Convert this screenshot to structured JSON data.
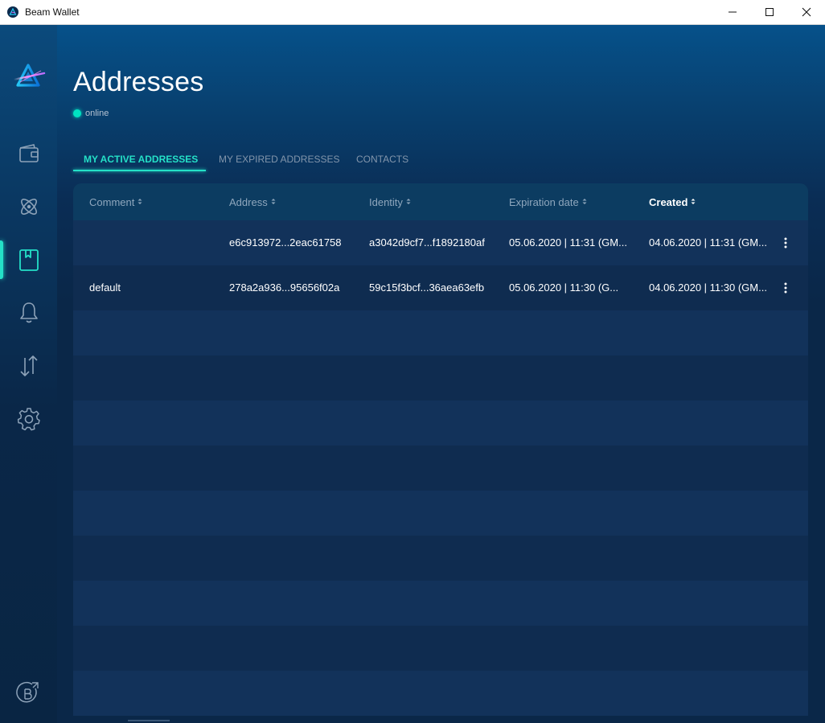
{
  "window": {
    "title": "Beam Wallet"
  },
  "page": {
    "title": "Addresses",
    "status": "online"
  },
  "sidebar": {
    "items": [
      {
        "name": "wallet",
        "icon": "wallet-icon"
      },
      {
        "name": "atomic-swap",
        "icon": "atom-icon"
      },
      {
        "name": "addresses",
        "icon": "address-book-icon",
        "active": true
      },
      {
        "name": "notifications",
        "icon": "bell-icon"
      },
      {
        "name": "utxo",
        "icon": "transfer-arrows-icon"
      },
      {
        "name": "settings",
        "icon": "gear-icon"
      }
    ],
    "bottom_icon": "beam-explorer-link-icon"
  },
  "tabs": [
    {
      "label": "MY ACTIVE ADDRESSES",
      "active": true
    },
    {
      "label": "MY EXPIRED ADDRESSES",
      "active": false
    },
    {
      "label": "CONTACTS",
      "active": false
    }
  ],
  "table": {
    "columns": [
      {
        "label": "Comment",
        "sorted": false
      },
      {
        "label": "Address",
        "sorted": false
      },
      {
        "label": "Identity",
        "sorted": false
      },
      {
        "label": "Expiration date",
        "sorted": false
      },
      {
        "label": "Created",
        "sorted": true
      }
    ],
    "rows": [
      {
        "comment": "",
        "address": "e6c913972...2eac61758",
        "identity": "a3042d9cf7...f1892180af",
        "expiration": "05.06.2020 | 11:31 (GM...",
        "created": "04.06.2020 | 11:31 (GM..."
      },
      {
        "comment": "default",
        "address": "278a2a936...95656f02a",
        "identity": "59c15f3bcf...36aea63efb",
        "expiration": "05.06.2020 | 11:30 (G...",
        "created": "04.06.2020 | 11:30 (GM..."
      }
    ]
  },
  "colors": {
    "accent": "#24e0c7",
    "background": "#0a2748",
    "row_odd": "#12325a",
    "row_even": "#0f2c50",
    "header": "#0c3c61"
  }
}
